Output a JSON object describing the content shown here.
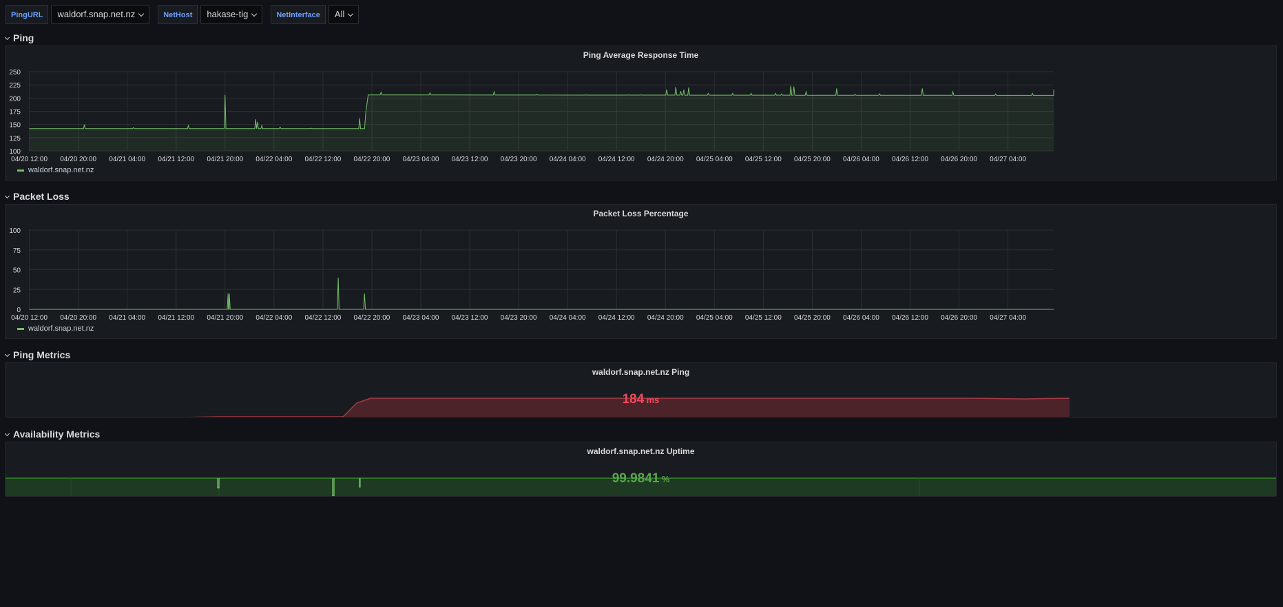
{
  "variables": [
    {
      "label": "PingURL",
      "value": "waldorf.snap.net.nz"
    },
    {
      "label": "NetHost",
      "value": "hakase-tig"
    },
    {
      "label": "NetInterface",
      "value": "All"
    }
  ],
  "rows": {
    "ping": "Ping",
    "packet_loss": "Packet Loss",
    "ping_metrics": "Ping Metrics",
    "availability": "Availability Metrics"
  },
  "panels": {
    "ping_avg": {
      "title": "Ping Average Response Time",
      "legend": "waldorf.snap.net.nz"
    },
    "packet_loss": {
      "title": "Packet Loss Percentage",
      "legend": "waldorf.snap.net.nz"
    },
    "ping_stat": {
      "title": "waldorf.snap.net.nz Ping",
      "value": "184",
      "unit": "ms",
      "color": "#f2495c"
    },
    "uptime_stat": {
      "title": "waldorf.snap.net.nz Uptime",
      "value": "99.9841",
      "unit": "%",
      "color": "#73bf69"
    }
  },
  "colors": {
    "series": "#73bf69",
    "background": "#111217",
    "panel": "#181b1f"
  },
  "chart_data": [
    {
      "type": "line",
      "title": "Ping Average Response Time",
      "x_ticks": [
        "04/20 12:00",
        "04/20 20:00",
        "04/21 04:00",
        "04/21 12:00",
        "04/21 20:00",
        "04/22 04:00",
        "04/22 12:00",
        "04/22 20:00",
        "04/23 04:00",
        "04/23 12:00",
        "04/23 20:00",
        "04/24 04:00",
        "04/24 12:00",
        "04/24 20:00",
        "04/25 04:00",
        "04/25 12:00",
        "04/25 20:00",
        "04/26 04:00",
        "04/26 12:00",
        "04/26 20:00",
        "04/27 04:00"
      ],
      "y_ticks": [
        100,
        125,
        150,
        175,
        200,
        225,
        250
      ],
      "ylim": [
        100,
        250
      ],
      "x_range_hours": [
        0,
        170
      ],
      "series": [
        {
          "name": "waldorf.snap.net.nz",
          "baseline": [
            [
              0,
              142
            ],
            [
              54.8,
              142
            ],
            [
              55,
              172
            ],
            [
              55.4,
              206
            ],
            [
              180,
              205
            ]
          ],
          "spikes": [
            [
              9,
              150
            ],
            [
              17,
              144
            ],
            [
              26,
              148
            ],
            [
              32,
              206
            ],
            [
              37,
              160
            ],
            [
              37.3,
              155
            ],
            [
              38,
              148
            ],
            [
              41,
              145
            ],
            [
              46,
              143
            ],
            [
              54,
              162
            ],
            [
              57.5,
              211
            ],
            [
              65.5,
              210
            ],
            [
              76,
              212
            ],
            [
              83,
              207
            ],
            [
              91,
              206
            ],
            [
              98,
              206
            ],
            [
              100,
              206
            ],
            [
              104.2,
              216
            ],
            [
              105.7,
              221
            ],
            [
              106.5,
              213
            ],
            [
              107,
              216
            ],
            [
              107.8,
              220
            ],
            [
              111,
              209
            ],
            [
              115,
              209
            ],
            [
              118,
              209
            ],
            [
              122,
              209
            ],
            [
              123,
              208
            ],
            [
              124.5,
              223
            ],
            [
              125,
              222
            ],
            [
              127,
              212
            ],
            [
              132,
              218
            ],
            [
              135,
              207
            ],
            [
              139,
              208
            ],
            [
              146,
              218
            ],
            [
              151,
              212
            ],
            [
              158,
              208
            ],
            [
              164,
              209
            ],
            [
              168,
              216
            ]
          ]
        }
      ]
    },
    {
      "type": "line",
      "title": "Packet Loss Percentage",
      "x_ticks": [
        "04/20 12:00",
        "04/20 20:00",
        "04/21 04:00",
        "04/21 12:00",
        "04/21 20:00",
        "04/22 04:00",
        "04/22 12:00",
        "04/22 20:00",
        "04/23 04:00",
        "04/23 12:00",
        "04/23 20:00",
        "04/24 04:00",
        "04/24 12:00",
        "04/24 20:00",
        "04/25 04:00",
        "04/25 12:00",
        "04/25 20:00",
        "04/26 04:00",
        "04/26 12:00",
        "04/26 20:00",
        "04/27 04:00"
      ],
      "y_ticks": [
        0,
        25,
        50,
        75,
        100
      ],
      "ylim": [
        0,
        100
      ],
      "x_range_hours": [
        0,
        170
      ],
      "series": [
        {
          "name": "waldorf.snap.net.nz",
          "baseline": [
            [
              0,
              0
            ],
            [
              180,
              0
            ]
          ],
          "spikes": [
            [
              32.5,
              20
            ],
            [
              32.7,
              20
            ],
            [
              50.5,
              40
            ],
            [
              54.8,
              20
            ]
          ]
        }
      ]
    }
  ]
}
